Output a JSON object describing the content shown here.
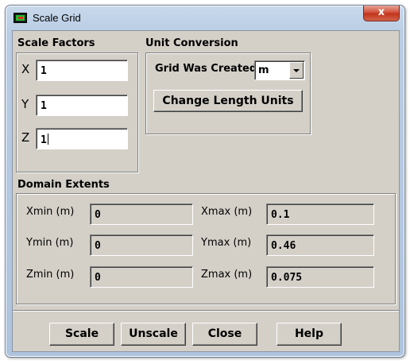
{
  "window": {
    "title": "Scale Grid",
    "close_glyph": "x"
  },
  "scale_factors": {
    "heading": "Scale Factors",
    "x_label": "X",
    "x_value": "1",
    "y_label": "Y",
    "y_value": "1",
    "z_label": "Z",
    "z_value": "1"
  },
  "unit_conversion": {
    "heading": "Unit Conversion",
    "grid_created_label": "Grid Was Created In",
    "grid_unit": "m",
    "change_units_label": "Change Length Units"
  },
  "domain_extents": {
    "heading": "Domain Extents",
    "xmin_label": "Xmin (m)",
    "xmin_value": "0",
    "ymin_label": "Ymin (m)",
    "ymin_value": "0",
    "zmin_label": "Zmin (m)",
    "zmin_value": "0",
    "xmax_label": "Xmax (m)",
    "xmax_value": "0.1",
    "ymax_label": "Ymax (m)",
    "ymax_value": "0.46",
    "zmax_label": "Zmax (m)",
    "zmax_value": "0.075"
  },
  "buttons": {
    "scale": "Scale",
    "unscale": "Unscale",
    "close": "Close",
    "help": "Help"
  },
  "icons": {
    "app": "fluent-app-icon",
    "close": "close-icon",
    "dropdown": "chevron-down-icon"
  },
  "colors": {
    "titlebar": "#b9cde4",
    "dialog_bg": "#d4d0c8",
    "close_button": "#c23218"
  }
}
